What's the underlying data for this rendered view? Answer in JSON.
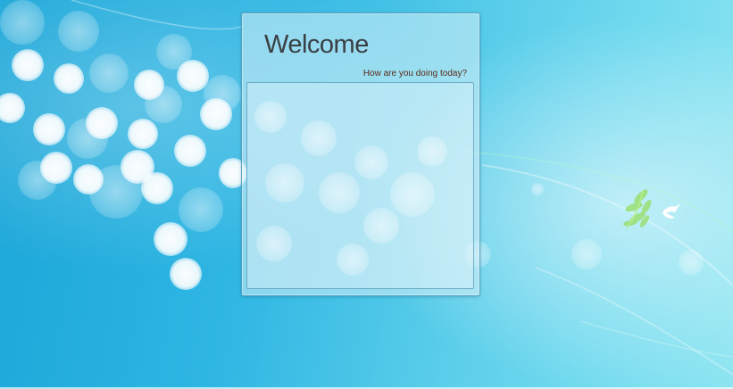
{
  "window": {
    "title": "Welcome",
    "subtitle": "How are you doing today?"
  },
  "colors": {
    "background_primary": "#2fb6e3",
    "background_light": "#8de5f1",
    "title_text": "#3a3f44",
    "subtitle_text": "#5a2c18",
    "panel_border": "#4696b9"
  },
  "icons": {
    "decoration": "bird-and-leaves-icon"
  }
}
